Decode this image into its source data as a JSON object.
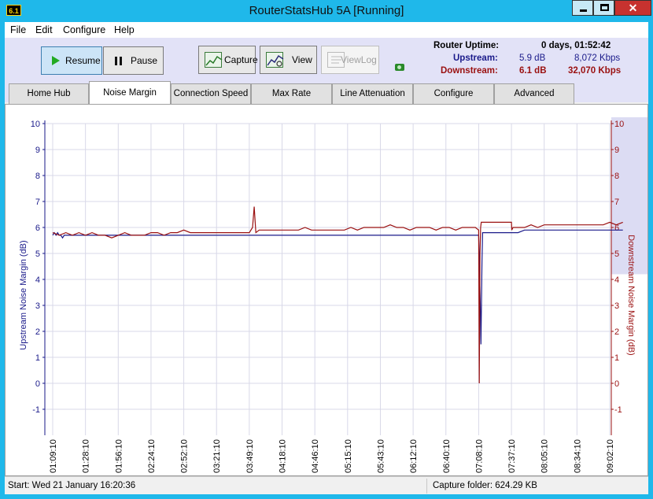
{
  "window": {
    "app_icon_text": "6.1",
    "title": "RouterStatsHub 5A  [Running]",
    "close_glyph": "✕"
  },
  "menu": [
    "File",
    "Edit",
    "Configure",
    "Help"
  ],
  "toolbar": {
    "resume_label": "Resume",
    "pause_label": "Pause",
    "capture_label": "Capture",
    "view_label": "View",
    "viewlog_label": "ViewLog"
  },
  "stats": {
    "uptime_label": "Router Uptime:",
    "uptime_value": "0 days, 01:52:42",
    "upstream_label": "Upstream:",
    "upstream_snr": "5.9 dB",
    "upstream_rate": "8,072 Kbps",
    "downstream_label": "Downstream:",
    "downstream_snr": "6.1 dB",
    "downstream_rate": "32,070 Kbps",
    "colors": {
      "upstream": "#1a1a8a",
      "downstream": "#9a1010"
    }
  },
  "tabs": [
    "Home Hub",
    "Noise Margin",
    "Connection Speed",
    "Max Rate",
    "Line Attenuation",
    "Configure",
    "Advanced"
  ],
  "active_tab": "Noise Margin",
  "status": {
    "start": "Start: Wed 21 January 16:20:36",
    "capture": "Capture folder:  624.29 KB"
  },
  "chart_data": {
    "type": "line",
    "ylabel": "Upstream Noise Margin (dB)",
    "y2label": "Downstream Noise Margin (dB)",
    "ylim": [
      -2,
      10
    ],
    "y_ticks": [
      -1,
      0,
      1,
      2,
      3,
      4,
      5,
      6,
      7,
      8,
      9,
      10
    ],
    "x_ticks": [
      "01:09:10",
      "01:28:10",
      "01:56:10",
      "02:24:10",
      "02:52:10",
      "03:21:10",
      "03:49:10",
      "04:18:10",
      "04:46:10",
      "05:15:10",
      "05:43:10",
      "06:12:10",
      "06:40:10",
      "07:08:10",
      "07:37:10",
      "08:05:10",
      "08:34:10",
      "09:02:10"
    ],
    "grid": true,
    "series": [
      {
        "name": "Upstream",
        "color": "#1a1a8a",
        "x": [
          0,
          0.05,
          0.1,
          0.15,
          0.2,
          0.25,
          0.3,
          0.35,
          0.4,
          0.45,
          0.5,
          0.55,
          0.6,
          0.65,
          0.7,
          0.72,
          0.76,
          0.78,
          0.8,
          0.82,
          0.84,
          0.846,
          0.848,
          0.85,
          0.86,
          0.88,
          0.9,
          0.95,
          1.0,
          1.05,
          1.1,
          1.15,
          1.2,
          1.25,
          1.3,
          1.35,
          1.4,
          1.45,
          1.5,
          1.55,
          1.6,
          1.65,
          1.7,
          1.75,
          1.8,
          1.85,
          1.9,
          1.95,
          2.0,
          2.1,
          2.2,
          2.3,
          2.4,
          2.5,
          2.6,
          2.7,
          2.8,
          2.9,
          3.0,
          3.2,
          3.4,
          3.6,
          3.8,
          4.0,
          4.2,
          4.4,
          4.6,
          4.8,
          5.0,
          5.2,
          5.4,
          5.6,
          5.8,
          6.0,
          6.2,
          6.4,
          6.6,
          6.8,
          7.0,
          7.2,
          7.4,
          7.6,
          7.8,
          8.0,
          8.2,
          8.4,
          8.6,
          8.8,
          9.0,
          9.2,
          9.4,
          9.6,
          9.8,
          10.0,
          10.2,
          10.4,
          10.6,
          10.8,
          11.0,
          11.2,
          11.4,
          11.6,
          11.8,
          12.0,
          12.2,
          12.4,
          12.6,
          12.8,
          13.0,
          13.05,
          13.07,
          13.1,
          13.12,
          13.14,
          13.2,
          13.4,
          13.6,
          13.8,
          14.0,
          14.2,
          14.4,
          14.6,
          14.8,
          15.0,
          15.2,
          15.4,
          15.6,
          15.8,
          16.0,
          16.2,
          16.4,
          16.6,
          16.8,
          17.0,
          17.2,
          17.4
        ],
        "values": [
          5.7,
          5.8,
          5.7,
          5.8,
          5.7,
          5.7,
          5.6,
          5.7,
          5.7,
          5.7,
          5.7,
          5.7,
          5.7,
          5.7,
          5.7,
          5.7,
          5.7,
          5.7,
          5.7,
          5.7,
          5.7,
          5.7,
          5.7,
          5.7,
          5.7,
          5.7,
          5.7,
          5.7,
          5.7,
          5.7,
          5.7,
          5.7,
          5.7,
          5.7,
          5.7,
          5.7,
          5.7,
          5.7,
          5.7,
          5.7,
          5.7,
          5.7,
          5.7,
          5.7,
          5.7,
          5.7,
          5.7,
          5.7,
          5.7,
          5.7,
          5.7,
          5.7,
          5.7,
          5.7,
          5.7,
          5.7,
          5.7,
          5.7,
          5.7,
          5.7,
          5.7,
          5.7,
          5.7,
          5.7,
          5.7,
          5.7,
          5.7,
          5.7,
          5.7,
          5.7,
          5.7,
          5.7,
          5.7,
          5.7,
          5.7,
          5.7,
          5.7,
          5.7,
          5.7,
          5.7,
          5.7,
          5.7,
          5.7,
          5.7,
          5.7,
          5.7,
          5.7,
          5.7,
          5.7,
          5.7,
          5.7,
          5.7,
          5.7,
          5.7,
          5.7,
          5.7,
          5.7,
          5.7,
          5.7,
          5.7,
          5.7,
          5.7,
          5.7,
          5.7,
          5.7,
          5.7,
          5.7,
          5.7,
          5.7,
          3.0,
          1.5,
          4.6,
          5.8,
          5.8,
          5.8,
          5.8,
          5.8,
          5.8,
          5.8,
          5.8,
          5.9,
          5.9,
          5.9,
          5.9,
          5.9,
          5.9,
          5.9,
          5.9,
          5.9,
          5.9,
          5.9,
          5.9,
          5.9,
          5.9,
          5.9,
          5.9
        ]
      },
      {
        "name": "Downstream",
        "color": "#9a1010",
        "x": [
          0,
          0.2,
          0.4,
          0.6,
          0.8,
          1.0,
          1.2,
          1.4,
          1.6,
          1.8,
          2.0,
          2.2,
          2.4,
          2.6,
          2.8,
          3.0,
          3.2,
          3.4,
          3.6,
          3.8,
          4.0,
          4.2,
          4.4,
          4.6,
          4.8,
          5.0,
          5.2,
          5.4,
          5.6,
          5.8,
          6.0,
          6.1,
          6.15,
          6.2,
          6.3,
          6.5,
          6.7,
          6.9,
          7.1,
          7.3,
          7.5,
          7.7,
          7.9,
          8.1,
          8.3,
          8.5,
          8.7,
          8.9,
          9.1,
          9.3,
          9.5,
          9.7,
          9.9,
          10.1,
          10.3,
          10.5,
          10.7,
          10.9,
          11.1,
          11.3,
          11.5,
          11.7,
          11.9,
          12.1,
          12.3,
          12.5,
          12.7,
          12.9,
          13.0,
          13.02,
          13.04,
          13.06,
          13.08,
          13.1,
          13.2,
          13.4,
          13.6,
          13.8,
          14.0,
          14.01,
          14.05,
          14.2,
          14.4,
          14.6,
          14.8,
          15.0,
          15.2,
          15.4,
          15.6,
          15.8,
          16.0,
          16.2,
          16.4,
          16.6,
          16.8,
          17.0,
          17.2,
          17.4
        ],
        "values": [
          5.8,
          5.7,
          5.8,
          5.7,
          5.8,
          5.7,
          5.8,
          5.7,
          5.7,
          5.6,
          5.7,
          5.8,
          5.7,
          5.7,
          5.7,
          5.8,
          5.8,
          5.7,
          5.8,
          5.8,
          5.9,
          5.8,
          5.8,
          5.8,
          5.8,
          5.8,
          5.8,
          5.8,
          5.8,
          5.8,
          5.8,
          6.0,
          6.8,
          5.8,
          5.9,
          5.9,
          5.9,
          5.9,
          5.9,
          5.9,
          5.9,
          6.0,
          5.9,
          5.9,
          5.9,
          5.9,
          5.9,
          5.9,
          6.0,
          5.9,
          6.0,
          6.0,
          6.0,
          6.0,
          6.1,
          6.0,
          6.0,
          5.9,
          6.0,
          6.0,
          6.0,
          5.9,
          6.0,
          6.0,
          5.9,
          6.0,
          6.0,
          6.0,
          5.9,
          0.0,
          5.0,
          6.0,
          6.2,
          6.2,
          6.2,
          6.2,
          6.2,
          6.2,
          6.2,
          5.9,
          6.0,
          6.0,
          6.0,
          6.1,
          6.0,
          6.1,
          6.1,
          6.1,
          6.1,
          6.1,
          6.1,
          6.1,
          6.1,
          6.1,
          6.1,
          6.2,
          6.1,
          6.2
        ]
      }
    ],
    "y2_highlight": [
      4.2,
      10
    ]
  }
}
